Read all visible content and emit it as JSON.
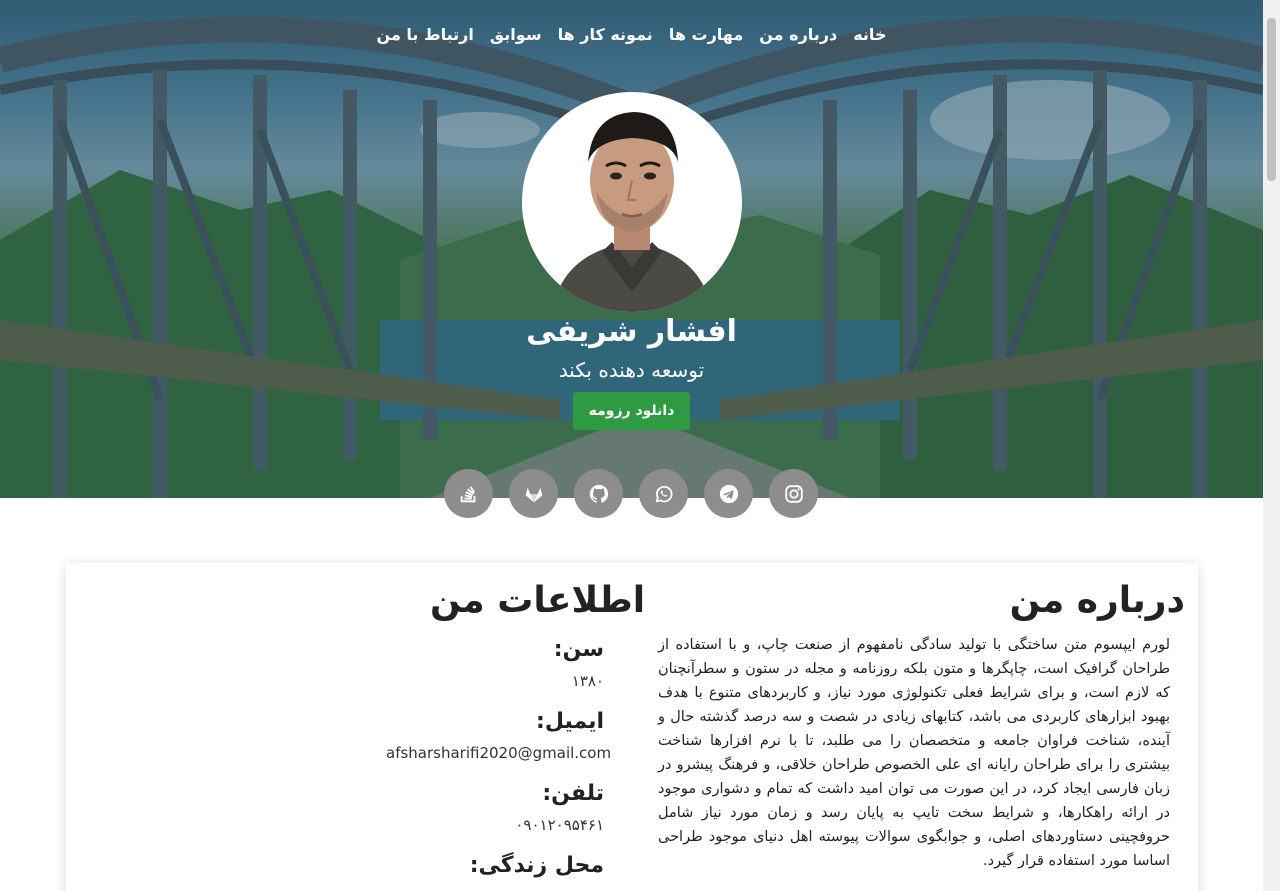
{
  "nav": {
    "items": [
      "خانه",
      "درباره من",
      "مهارت ها",
      "نمونه کار ها",
      "سوابق",
      "ارتباط با من"
    ]
  },
  "hero": {
    "name": "افشار شریفی",
    "role": "توسعه دهنده بکند",
    "cv_button": "دانلود رزومه"
  },
  "socials": [
    {
      "icon": "stackoverflow-icon"
    },
    {
      "icon": "gitlab-icon"
    },
    {
      "icon": "github-icon"
    },
    {
      "icon": "whatsapp-icon"
    },
    {
      "icon": "telegram-icon"
    },
    {
      "icon": "instagram-icon"
    }
  ],
  "about": {
    "title": "درباره من",
    "text": "لورم ایپسوم متن ساختگی با تولید سادگی نامفهوم از صنعت چاپ، و با استفاده از طراحان گرافیک است، چاپگرها و متون بلکه روزنامه و مجله در ستون و سطرآنچنان که لازم است، و برای شرایط فعلی تکنولوژی مورد نیاز، و کاربردهای متنوع با هدف بهبود ابزارهای کاربردی می باشد، کتابهای زیادی در شصت و سه درصد گذشته حال و آینده، شناخت فراوان جامعه و متخصصان را می طلبد، تا با نرم افزارها شناخت بیشتری را برای طراحان رایانه ای علی الخصوص طراحان خلاقی، و فرهنگ پیشرو در زبان فارسی ایجاد کرد، در این صورت می توان امید داشت که تمام و دشواری موجود در ارائه راهکارها، و شرایط سخت تایپ به پایان رسد و زمان مورد نیاز شامل حروفچینی دستاوردهای اصلی، و جوابگوی سوالات پیوسته اهل دنیای موجود طراحی اساسا مورد استفاده قرار گیرد."
  },
  "info": {
    "title": "اطلاعات من",
    "age_label": "سن:",
    "age_value": "۱۳۸۰",
    "email_label": "ایمیل:",
    "email_value": "afsharsharifi2020@gmail.com",
    "phone_label": "تلفن:",
    "phone_value": "۰۹۰۱۲۰۹۵۴۶۱",
    "location_label": "محل زندگی:"
  },
  "colors": {
    "accent_green": "#2e9a42",
    "social_gray": "#8d8d8d"
  }
}
